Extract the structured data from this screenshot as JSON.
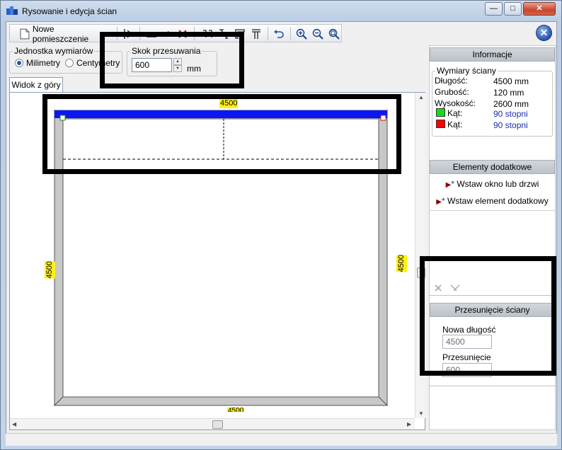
{
  "window": {
    "title": "Rysowanie i edycja ścian",
    "minimize": "—",
    "maximize": "□",
    "close": "✕"
  },
  "toolbar": {
    "new_room_label": "Nowe pomieszczenie",
    "help": "✕"
  },
  "units": {
    "legend": "Jednostka wymiarów",
    "options": [
      "Milimetry",
      "Centymetry"
    ],
    "selected": "Milimetry"
  },
  "step": {
    "legend": "Skok przesuwania",
    "value": "600",
    "unit": "mm"
  },
  "view_tab": "Widok z góry",
  "drawing": {
    "top_dimension": "4500",
    "left_dimension": "4500",
    "right_dimension": "4500",
    "bottom_dimension": "4500",
    "accent_color": "#0a16f5",
    "wall_color": "#c8c8c8"
  },
  "info": {
    "header": "Informacje",
    "group_title": "Wymiary ściany",
    "rows": [
      {
        "label": "Długość:",
        "value": "4500 mm"
      },
      {
        "label": "Grubość:",
        "value": "120 mm"
      },
      {
        "label": "Wysokość:",
        "value": "2600 mm"
      }
    ],
    "angles": [
      {
        "label": "Kąt:",
        "value": "90 stopni",
        "color": "#10e010"
      },
      {
        "label": "Kąt:",
        "value": "90 stopni",
        "color": "#ff0000"
      }
    ]
  },
  "extras": {
    "header": "Elementy dodatkowe",
    "actions": [
      "Wstaw okno lub drzwi",
      "Wstaw element dodatkowy"
    ]
  },
  "shift": {
    "header": "Przesunięcie ściany",
    "new_length_label": "Nowa długość",
    "new_length_value": "4500",
    "offset_label": "Przesunięcie",
    "offset_value": "600"
  }
}
